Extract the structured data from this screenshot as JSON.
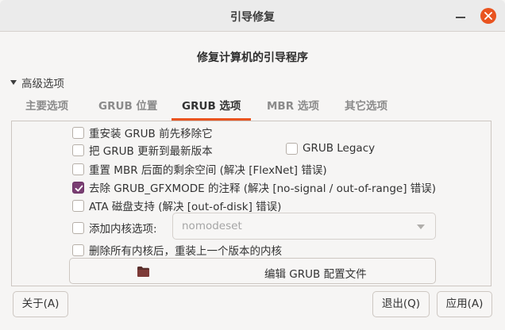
{
  "window": {
    "title": "引导修复"
  },
  "heading": "修复计算机的引导程序",
  "advanced_label": "高级选项",
  "tabs": [
    {
      "label": "主要选项",
      "active": false
    },
    {
      "label": "GRUB 位置",
      "active": false
    },
    {
      "label": "GRUB 选项",
      "active": true
    },
    {
      "label": "MBR 选项",
      "active": false
    },
    {
      "label": "其它选项",
      "active": false
    }
  ],
  "options": {
    "purge_grub": {
      "label": "重安装 GRUB 前先移除它",
      "checked": false
    },
    "upgrade_grub": {
      "label": "把 GRUB 更新到最新版本",
      "checked": false
    },
    "grub_legacy": {
      "label": "GRUB Legacy",
      "checked": false
    },
    "reset_mbr": {
      "label": "重置 MBR 后面的剩余空间 (解决 [FlexNet] 错误)",
      "checked": false
    },
    "remove_gfxmode": {
      "label": "去除 GRUB_GFXMODE 的注释 (解决 [no-signal / out-of-range] 错误)",
      "checked": true
    },
    "ata_support": {
      "label": "ATA 磁盘支持 (解决 [out-of-disk] 错误)",
      "checked": false
    },
    "kernel_option": {
      "label": "添加内核选项:",
      "checked": false
    },
    "remove_kernels": {
      "label": "删除所有内核后，重装上一个版本的内核",
      "checked": false
    }
  },
  "kernel_option_select": {
    "value": "nomodeset"
  },
  "edit_config": {
    "label": "编辑 GRUB 配置文件",
    "icon": "folder-icon"
  },
  "buttons": {
    "about": "关于(A)",
    "quit": "退出(Q)",
    "apply": "应用(A)"
  },
  "colors": {
    "accent": "#e95420",
    "checkbox_checked": "#7a3e73"
  }
}
